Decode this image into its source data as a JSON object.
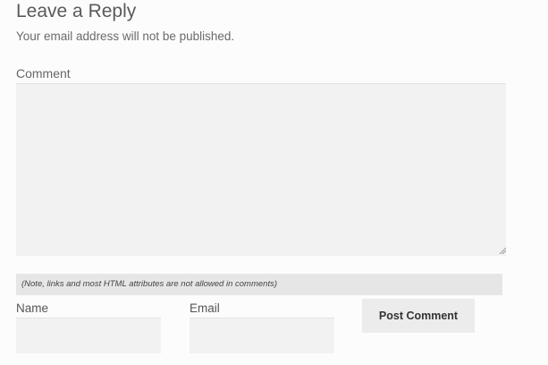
{
  "reply": {
    "title": "Leave a Reply",
    "notice": "Your email address will not be published."
  },
  "comment": {
    "label": "Comment",
    "value": ""
  },
  "note": "(Note, links and most HTML attributes are not allowed in comments)",
  "name_field": {
    "label": "Name",
    "value": ""
  },
  "email_field": {
    "label": "Email",
    "value": ""
  },
  "submit": {
    "label": "Post Comment"
  },
  "icons": {
    "resize": "resize-grip-icon"
  }
}
